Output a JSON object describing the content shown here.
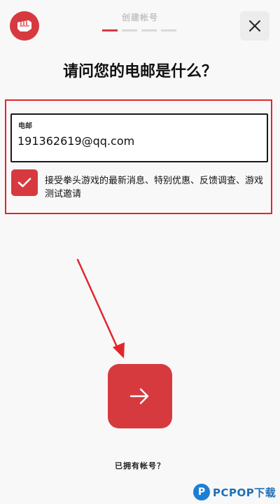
{
  "header": {
    "step_label": "创建帐号",
    "step_count": 4,
    "active_step": 1,
    "logo_icon": "fist-logo-icon",
    "close_icon": "close-icon"
  },
  "main": {
    "question": "请问您的电邮是什么？",
    "email_label": "电邮",
    "email_value": "191362619@qq.com",
    "consent_checked": true,
    "consent_text": "接受拳头游戏的最新消息、特别优惠、反馈调查、游戏测试邀请",
    "next_icon": "arrow-right-icon",
    "have_account": "已拥有帐号？"
  },
  "watermark": {
    "icon_letter": "P",
    "text": "PCPOP下载"
  },
  "colors": {
    "accent": "#d63a3f",
    "highlight": "#e3262d",
    "background": "#f8f8f8"
  }
}
